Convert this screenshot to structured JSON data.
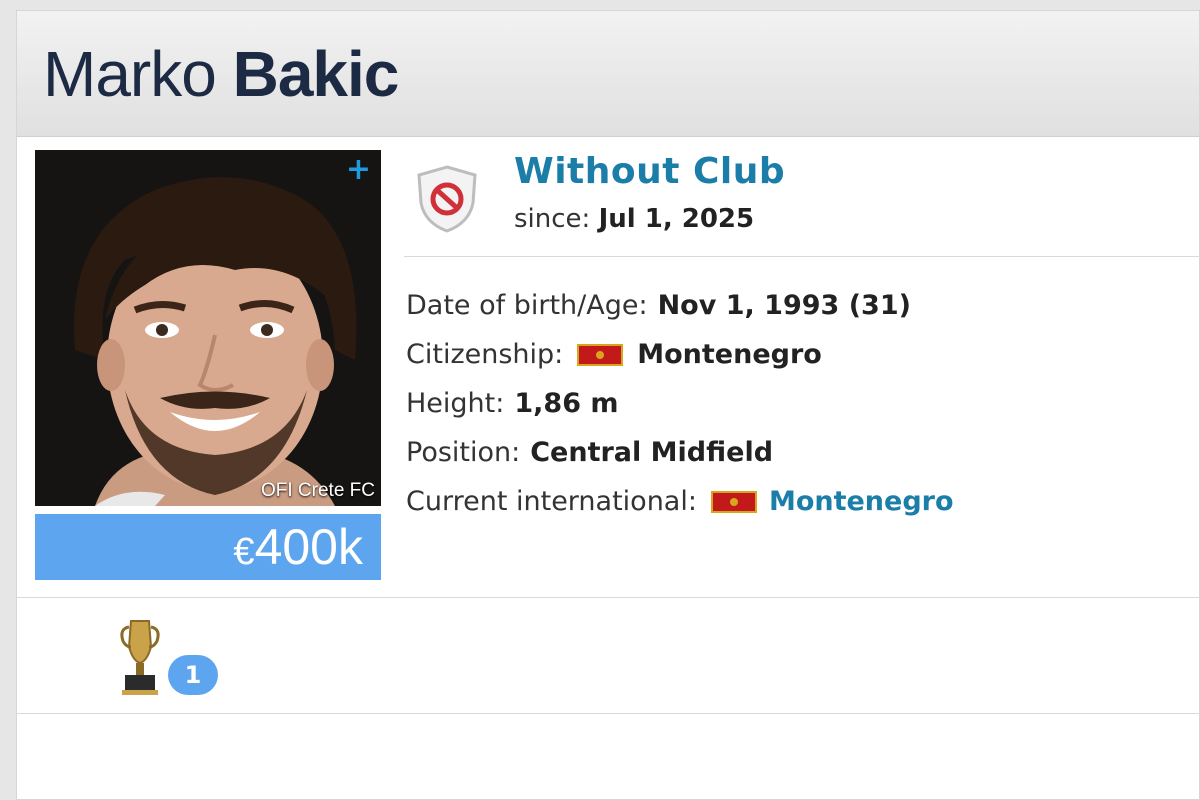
{
  "player": {
    "first_name": "Marko",
    "last_name": "Bakic"
  },
  "photo": {
    "club_caption": "OFI Crete FC",
    "plus_icon": "+",
    "background_color": "#161412"
  },
  "market_value": {
    "currency": "€",
    "amount": "400k",
    "color": "#5ea5f0"
  },
  "club": {
    "badge_icon": "no-club-shield-icon",
    "name": "Without Club",
    "since_label": "since:",
    "since_date": "Jul 1, 2025"
  },
  "info": {
    "dob_label": "Date of birth/Age:",
    "dob_value": "Nov 1, 1993 (31)",
    "citizenship_label": "Citizenship:",
    "citizenship_value": "Montenegro",
    "height_label": "Height:",
    "height_value": "1,86 m",
    "position_label": "Position:",
    "position_value": "Central Midfield",
    "international_label": "Current international:",
    "international_value": "Montenegro"
  },
  "achievements": {
    "trophy_icon": "trophy-icon",
    "count": "1"
  },
  "colors": {
    "link": "#1a7ea8",
    "name_text": "#1d2a44",
    "flag_red": "#c21a1a",
    "flag_gold": "#d9a51c"
  }
}
